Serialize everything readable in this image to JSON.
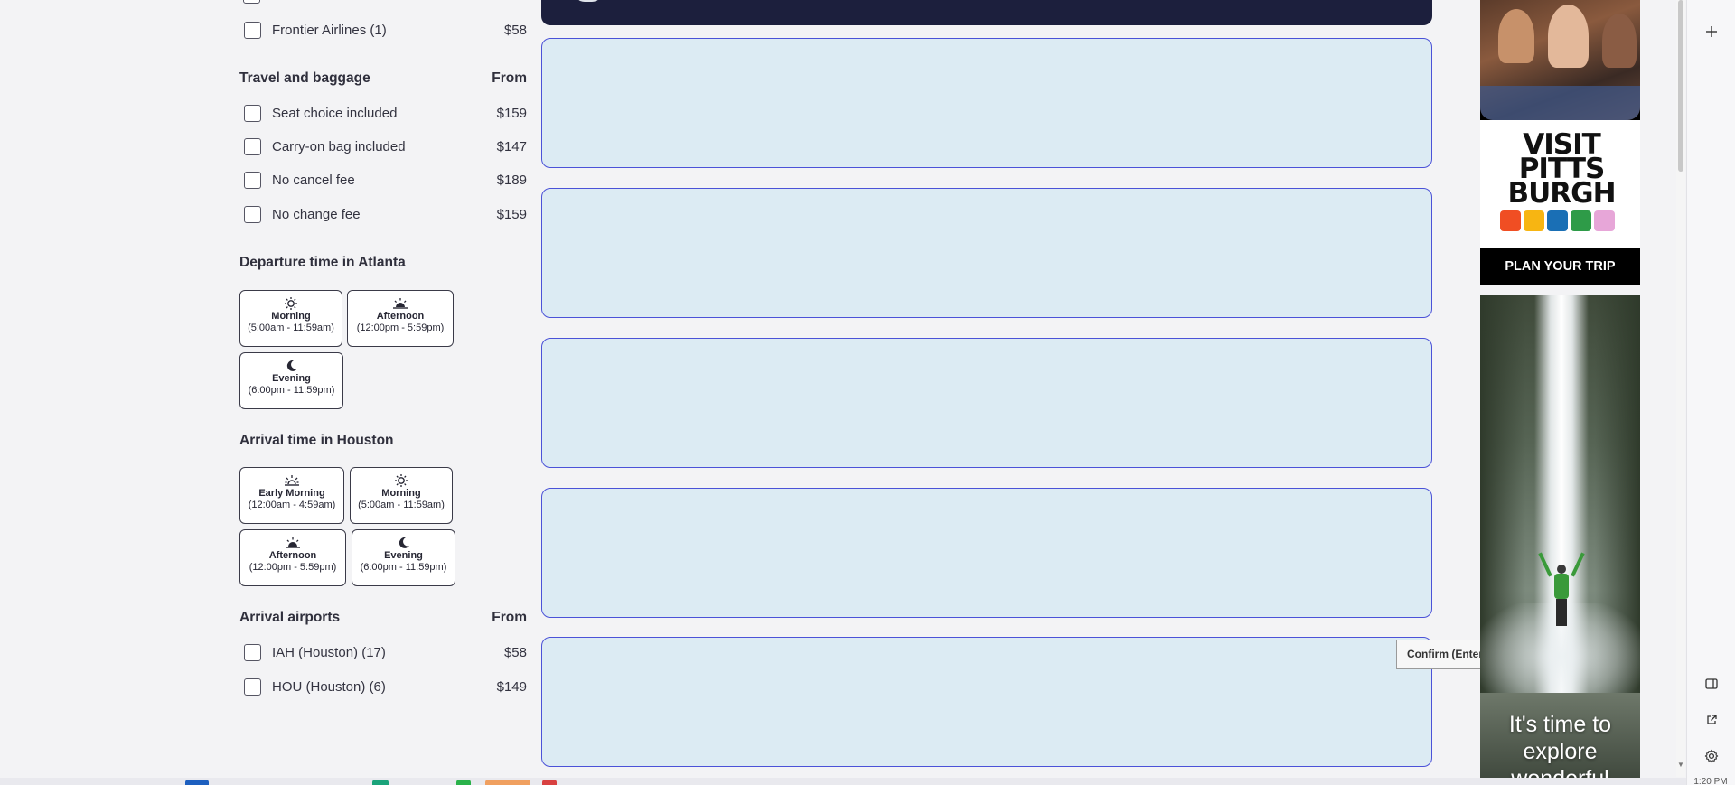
{
  "airlines": {
    "items": [
      {
        "label": "Frontier Airlines (1)",
        "price": "$58"
      }
    ]
  },
  "travel_baggage": {
    "title": "Travel and baggage",
    "from_label": "From",
    "items": [
      {
        "label": "Seat choice included",
        "price": "$159"
      },
      {
        "label": "Carry-on bag included",
        "price": "$147"
      },
      {
        "label": "No cancel fee",
        "price": "$189"
      },
      {
        "label": "No change fee",
        "price": "$159"
      }
    ]
  },
  "departure_time": {
    "title": "Departure time in Atlanta",
    "options": [
      {
        "name": "Morning",
        "range": "(5:00am - 11:59am)",
        "icon": "sun-icon"
      },
      {
        "name": "Afternoon",
        "range": "(12:00pm - 5:59pm)",
        "icon": "sunset-icon"
      },
      {
        "name": "Evening",
        "range": "(6:00pm - 11:59pm)",
        "icon": "moon-icon"
      }
    ]
  },
  "arrival_time": {
    "title": "Arrival time in Houston",
    "options": [
      {
        "name": "Early Morning",
        "range": "(12:00am - 4:59am)",
        "icon": "sunrise-icon"
      },
      {
        "name": "Morning",
        "range": "(5:00am - 11:59am)",
        "icon": "sun-icon"
      },
      {
        "name": "Afternoon",
        "range": "(12:00pm - 5:59pm)",
        "icon": "sunset-icon"
      },
      {
        "name": "Evening",
        "range": "(6:00pm - 11:59pm)",
        "icon": "moon-icon"
      }
    ]
  },
  "arrival_airports": {
    "title": "Arrival airports",
    "from_label": "From",
    "items": [
      {
        "label": "IAH (Houston) (17)",
        "price": "$58"
      },
      {
        "label": "HOU (Houston) (6)",
        "price": "$149"
      }
    ]
  },
  "ads": {
    "pittsburgh": {
      "brand": "VISIT PITTS BURGH",
      "cta": "PLAN YOUR TRIP",
      "swatch_colors": [
        "#f04e23",
        "#f7b512",
        "#1a6fb5",
        "#2e9b48",
        "#e7a6d8"
      ]
    },
    "waterfall": {
      "tagline": "It's time to explore wonderful"
    }
  },
  "tooltip": {
    "text": "Confirm (Enter)"
  },
  "side_panel": {
    "icons": [
      "plus-icon",
      "panel-icon",
      "external-link-icon",
      "gear-icon"
    ]
  },
  "clock": {
    "time": "1:20 PM"
  },
  "colors": {
    "card_bg": "#dcebf3",
    "card_border": "#4b52d8",
    "banner_dark": "#1c1f3d"
  }
}
